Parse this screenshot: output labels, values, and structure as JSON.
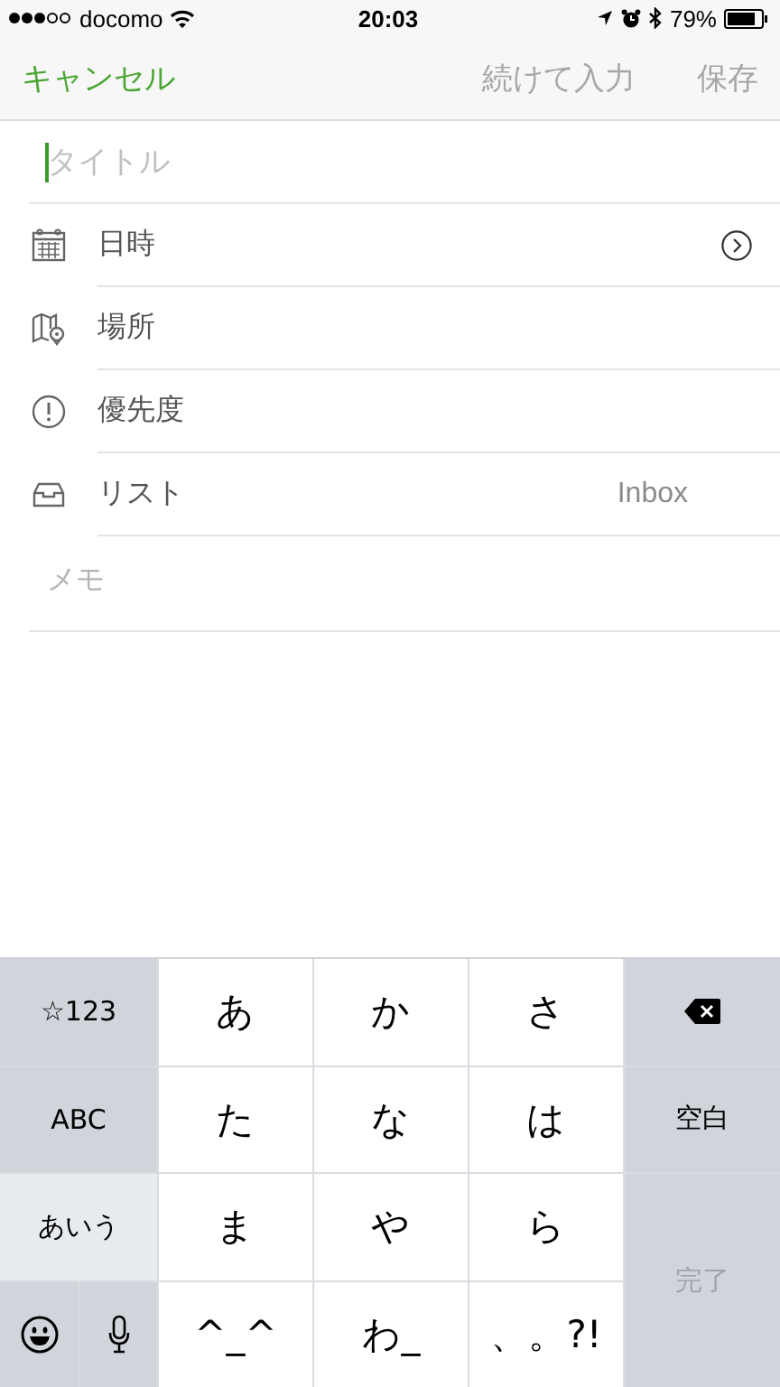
{
  "status_bar": {
    "carrier": "docomo",
    "time": "20:03",
    "battery": "79%"
  },
  "nav": {
    "cancel": "キャンセル",
    "actions": [
      {
        "label": "続けて入力",
        "disabled": true
      },
      {
        "label": "保存",
        "disabled": true
      }
    ]
  },
  "title_field": {
    "placeholder": "タイトル"
  },
  "rows": [
    {
      "kind": "calendar",
      "label": "日時",
      "chevron": true
    },
    {
      "kind": "map",
      "label": "場所",
      "chevron": false
    },
    {
      "kind": "priority",
      "label": "優先度",
      "chevron": false
    },
    {
      "kind": "tray",
      "label": "リスト",
      "value": "Inbox",
      "chevron": false
    }
  ],
  "memo": {
    "placeholder": "メモ"
  },
  "keyboard": {
    "modes": [
      {
        "label": "☆123",
        "selected": false
      },
      {
        "label": "ABC",
        "selected": false
      },
      {
        "label": "あいう",
        "selected": true
      }
    ],
    "keys": [
      "あ",
      "か",
      "さ",
      "た",
      "な",
      "は",
      "ま",
      "や",
      "ら",
      "^_^",
      "わ_",
      "、。?!"
    ],
    "space": "空白",
    "done": {
      "label": "完了",
      "disabled": true
    }
  }
}
